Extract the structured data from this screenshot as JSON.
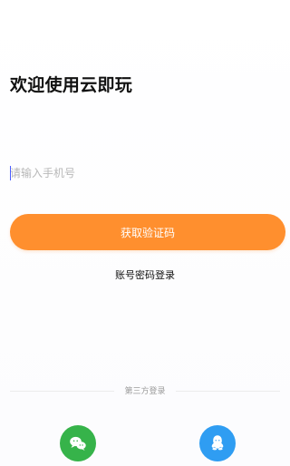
{
  "title": "欢迎使用云即玩",
  "phone": {
    "placeholder": "请输入手机号",
    "value": ""
  },
  "actions": {
    "get_code_label": "获取验证码",
    "password_login_label": "账号密码登录"
  },
  "third_party": {
    "label": "第三方登录",
    "providers": [
      {
        "name": "wechat",
        "icon": "wechat-icon",
        "color": "#36b34a"
      },
      {
        "name": "qq",
        "icon": "qq-icon",
        "color": "#2f9df2"
      }
    ]
  },
  "colors": {
    "accent": "#ff8f2e",
    "caret": "#4a5cff",
    "divider": "#ececec"
  }
}
